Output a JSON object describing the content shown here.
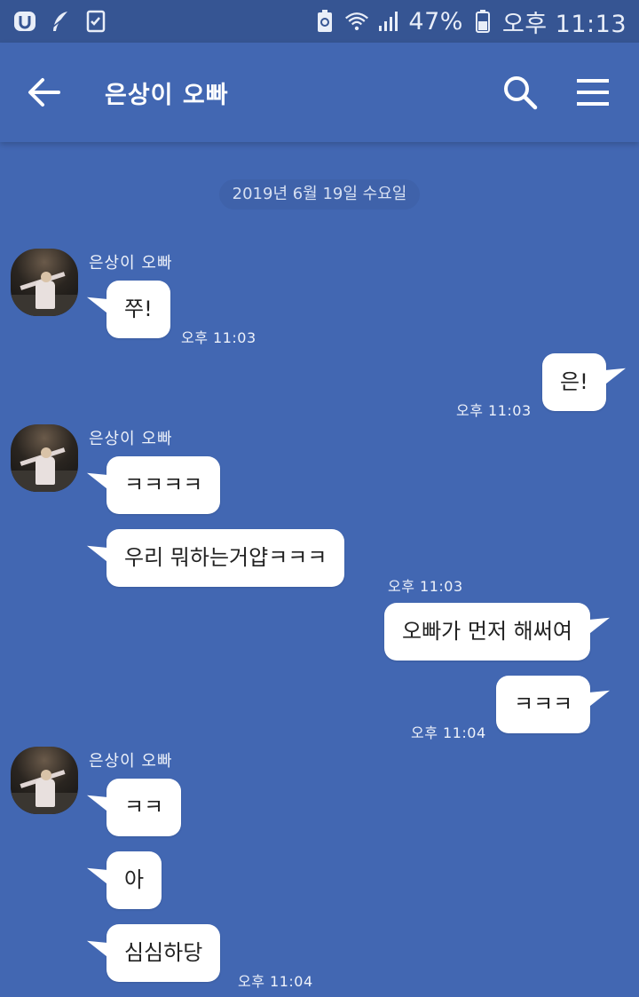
{
  "status_bar": {
    "battery_text": "47%",
    "clock": "오후 11:13"
  },
  "header": {
    "title": "은상이 오빠"
  },
  "chat": {
    "date_divider": "2019년 6월 19일 수요일",
    "messages": [
      {
        "sender": "은상이 오빠",
        "text": "쭈!",
        "time": "오후 11:03",
        "direction": "in"
      },
      {
        "text": "은!",
        "time": "오후 11:03",
        "direction": "out"
      },
      {
        "sender": "은상이 오빠",
        "text": "ㅋㅋㅋㅋ",
        "direction": "in"
      },
      {
        "text": "우리 뭐하는거얍ㅋㅋㅋ",
        "time": "오후 11:03",
        "direction": "in"
      },
      {
        "text": "오빠가 먼저 해써여",
        "direction": "out"
      },
      {
        "text": "ㅋㅋㅋ",
        "time": "오후 11:04",
        "direction": "out"
      },
      {
        "sender": "은상이 오빠",
        "text": "ㅋㅋ",
        "direction": "in"
      },
      {
        "text": "아",
        "direction": "in"
      },
      {
        "text": "심심하당",
        "time": "오후 11:04",
        "direction": "in"
      }
    ]
  },
  "colors": {
    "background": "#4267b2",
    "status_bar": "#365593",
    "bubble": "#ffffff"
  },
  "icons": [
    "app-u-icon",
    "feather-icon",
    "checklist-icon",
    "battery-saver-icon",
    "wifi-icon",
    "signal-icon",
    "battery-icon",
    "back-arrow-icon",
    "search-icon",
    "menu-icon"
  ]
}
